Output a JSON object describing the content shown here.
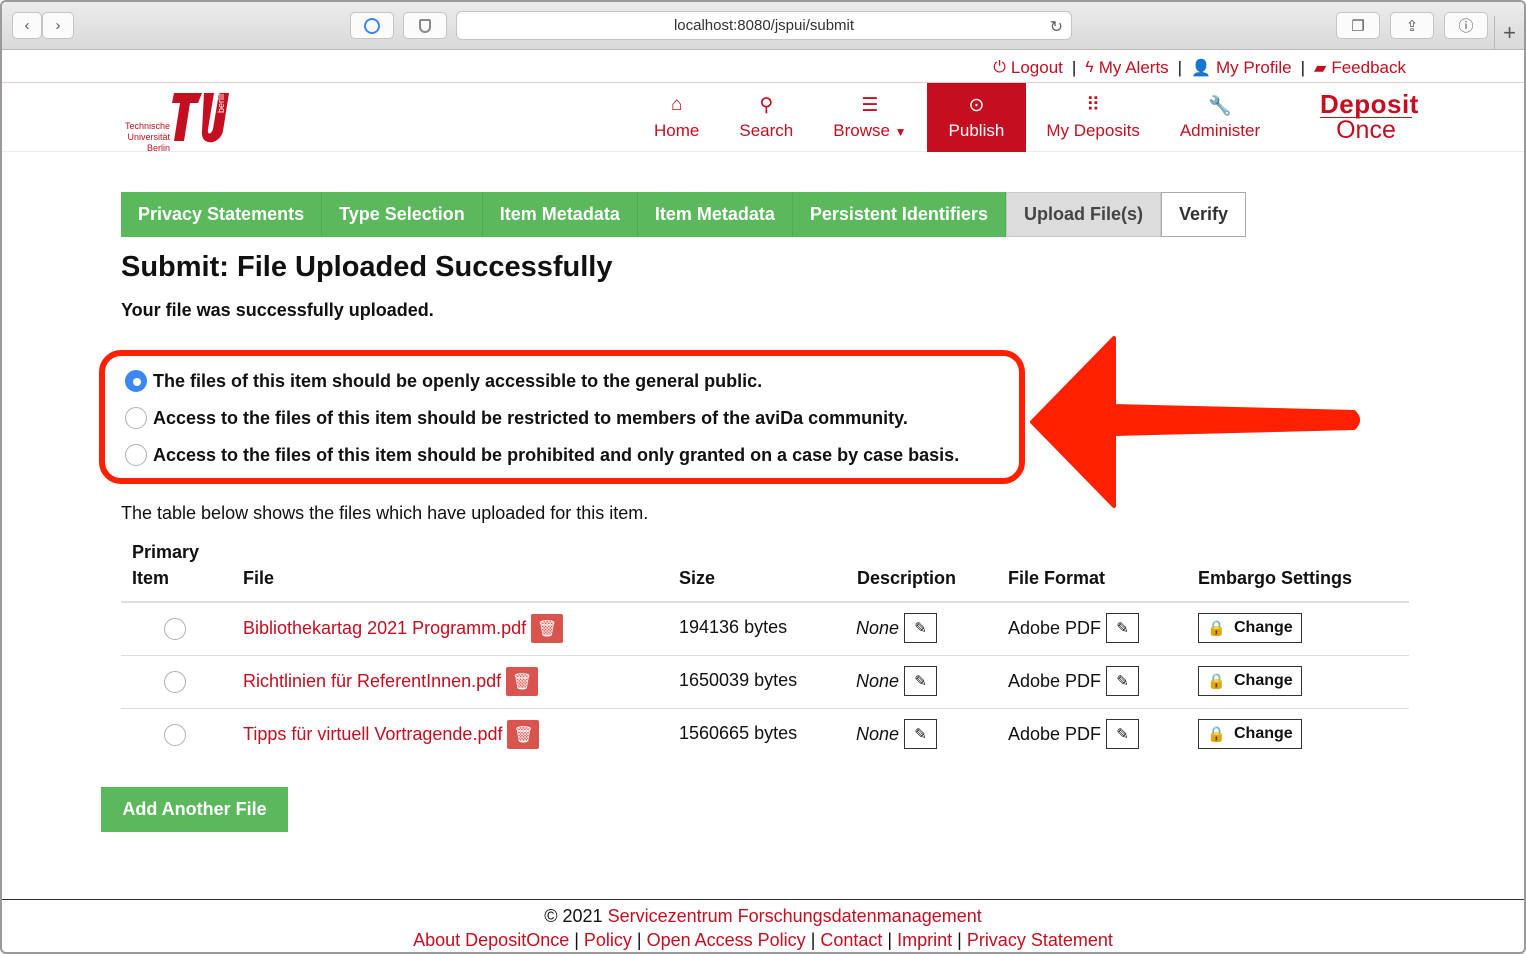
{
  "browser": {
    "url": "localhost:8080/jspui/submit"
  },
  "util": {
    "logout": "Logout",
    "alerts": "My Alerts",
    "profile": "My Profile",
    "feedback": "Feedback"
  },
  "logo": {
    "line1": "Technische",
    "line2": "Universität",
    "line3": "Berlin",
    "side": "berlin"
  },
  "nav": {
    "home": "Home",
    "search": "Search",
    "browse": "Browse",
    "publish": "Publish",
    "deposits": "My Deposits",
    "administer": "Administer"
  },
  "brand": {
    "line1": "Deposit",
    "line2": "Once"
  },
  "steps": [
    "Privacy Statements",
    "Type Selection",
    "Item Metadata",
    "Item Metadata",
    "Persistent Identifiers",
    "Upload File(s)",
    "Verify"
  ],
  "page": {
    "title": "Submit: File Uploaded Successfully",
    "success": "Your file was successfully uploaded."
  },
  "access": {
    "options": [
      "The files of this item should be openly accessible to the general public.",
      "Access to the files of this item should be restricted to members of the aviDa community.",
      "Access to the files of this item should be prohibited and only granted on a case by case basis."
    ],
    "selected_index": 0
  },
  "table": {
    "intro": "The table below shows the files which have uploaded for this item.",
    "headers": {
      "primary1": "Primary",
      "primary2": "Item",
      "file": "File",
      "size": "Size",
      "description": "Description",
      "format": "File Format",
      "embargo": "Embargo Settings"
    },
    "rows": [
      {
        "file": "Bibliothekartag 2021 Programm.pdf",
        "size": "194136 bytes",
        "description": "None",
        "format": "Adobe PDF",
        "embargo": "Change"
      },
      {
        "file": "Richtlinien für ReferentInnen.pdf",
        "size": "1650039 bytes",
        "description": "None",
        "format": "Adobe PDF",
        "embargo": "Change"
      },
      {
        "file": "Tipps für virtuell Vortragende.pdf",
        "size": "1560665 bytes",
        "description": "None",
        "format": "Adobe PDF",
        "embargo": "Change"
      }
    ]
  },
  "buttons": {
    "add_file": "Add Another File"
  },
  "footer": {
    "copyright": "© 2021",
    "org": "Servicezentrum Forschungsdatenmanagement",
    "links": [
      "About DepositOnce",
      "Policy",
      "Open Access Policy",
      "Contact",
      "Imprint",
      "Privacy Statement"
    ]
  },
  "colors": {
    "brand_red": "#c50e1f",
    "step_green": "#5cb85c",
    "annotation_red": "#ff2000",
    "radio_blue": "#3b87f4"
  }
}
